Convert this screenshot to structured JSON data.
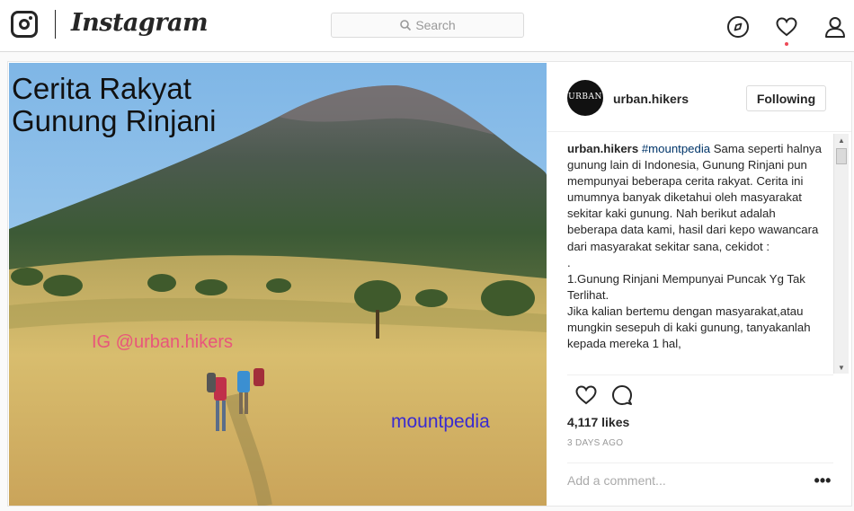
{
  "nav": {
    "wordmark": "Instagram",
    "search_placeholder": "Search",
    "icons": [
      "instagram-logo-icon",
      "search-icon",
      "compass-icon",
      "heart-icon",
      "profile-icon"
    ],
    "notification_dot_color": "#ed4956"
  },
  "post": {
    "image_text": {
      "title_line1": "Cerita Rakyat",
      "title_line2": "Gunung Rinjani",
      "ig_handle": "IG @urban.hikers",
      "watermark": "mountpedia"
    },
    "avatar_text": "URBAN",
    "username": "urban.hikers",
    "follow_label": "Following",
    "caption": {
      "username": "urban.hikers",
      "hashtag": "#mountpedia",
      "text": " Sama seperti halnya gunung lain di Indonesia, Gunung Rinjani pun mempunyai beberapa cerita rakyat. Cerita ini umumnya banyak diketahui oleh masyarakat sekitar kaki gunung. Nah berikut adalah beberapa data kami, hasil dari kepo wawancara dari masyarakat sekitar sana, cekidot :\n.\n1.Gunung Rinjani Mempunyai Puncak Yg Tak Terlihat.\nJika kalian bertemu dengan masyarakat,atau mungkin sesepuh di kaki gunung, tanyakanlah kepada mereka 1 hal,"
    },
    "likes": "4,117 likes",
    "time_ago": "3 DAYS AGO",
    "comment_placeholder": "Add a comment...",
    "more_label": "•••"
  }
}
